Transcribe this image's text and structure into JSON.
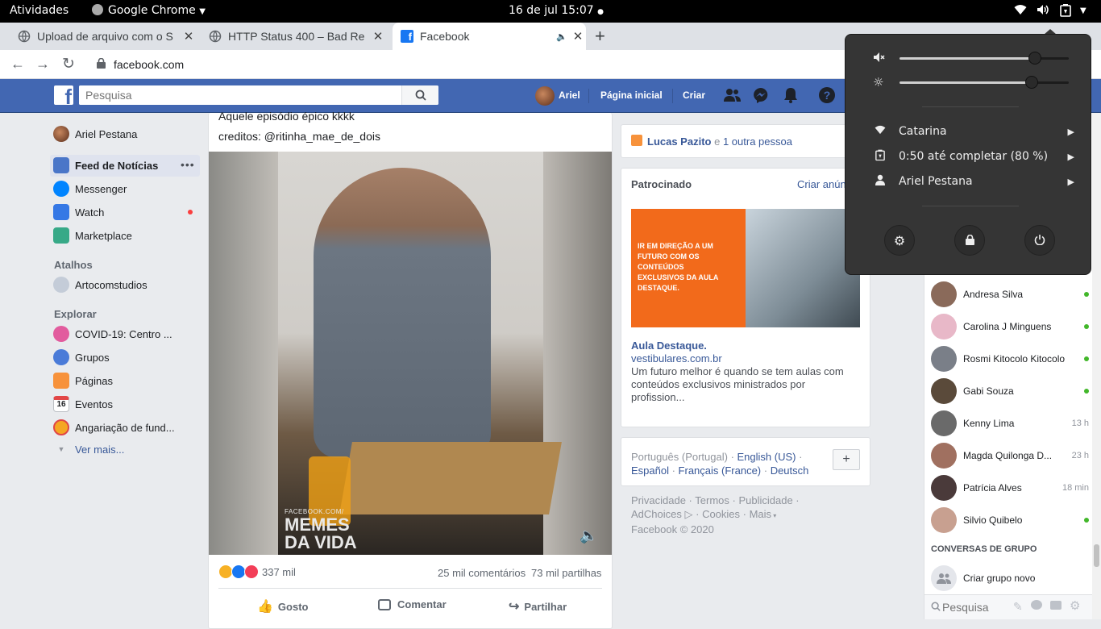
{
  "topbar": {
    "activities": "Atividades",
    "app_name": "Google Chrome",
    "clock": "16 de jul  15:07"
  },
  "tabs": [
    {
      "title": "Upload de arquivo com o S"
    },
    {
      "title": "HTTP Status 400 – Bad Re"
    },
    {
      "title": "Facebook"
    }
  ],
  "address": {
    "url": "facebook.com"
  },
  "fbbar": {
    "search_placeholder": "Pesquisa",
    "profile_name": "Ariel",
    "home": "Página inicial",
    "create": "Criar"
  },
  "left_nav": {
    "profile": "Ariel Pestana",
    "items": [
      {
        "label": "Feed de Notícias"
      },
      {
        "label": "Messenger"
      },
      {
        "label": "Watch"
      },
      {
        "label": "Marketplace"
      }
    ],
    "shortcuts_title": "Atalhos",
    "shortcuts": [
      {
        "label": "Artocomstudios"
      }
    ],
    "explore_title": "Explorar",
    "explore": [
      {
        "label": "COVID-19: Centro ..."
      },
      {
        "label": "Grupos"
      },
      {
        "label": "Páginas"
      },
      {
        "label": "Eventos"
      },
      {
        "label": "Angariação de fund..."
      }
    ],
    "see_more": "Ver mais...",
    "events_day": "16"
  },
  "post": {
    "text_line1": "Aquele episódio épico kkkk",
    "text_line2": "creditos: @ritinha_mae_de_dois",
    "watermark_small": "FACEBOOK.COM/",
    "watermark_big1": "MEMES",
    "watermark_big2": "DA VIDA",
    "reactions_count": "337 mil",
    "comments": "25 mil comentários",
    "shares": "73 mil partilhas",
    "action_like": "Gosto",
    "action_comment": "Comentar",
    "action_share": "Partilhar"
  },
  "birthday": {
    "name": "Lucas Pazito",
    "connector": "e",
    "others": "1 outra pessoa"
  },
  "sponsored": {
    "title": "Patrocinado",
    "create_ad": "Criar anún",
    "ad_image_text": "IR EM DIREÇÃO A UM FUTURO COM OS CONTEÚDOS EXCLUSIVOS DA AULA DESTAQUE.",
    "ad_name": "Aula Destaque.",
    "ad_domain": "vestibulares.com.br",
    "ad_desc": "Um futuro melhor é quando se tem aulas com conteúdos exclusivos ministrados por profission..."
  },
  "languages": {
    "current": "Português (Portugal)",
    "options": [
      "English (US)",
      "Español",
      "Français (France)",
      "Deutsch"
    ],
    "add": "+"
  },
  "footer": {
    "line1": [
      "Privacidade",
      "Termos",
      "Publicidade"
    ],
    "line2": [
      "AdChoices",
      "Cookies",
      "Mais"
    ],
    "copyright": "Facebook © 2020"
  },
  "chat": {
    "contacts": [
      {
        "name": "Andresa Silva",
        "status": "online"
      },
      {
        "name": "Carolina J Minguens",
        "status": "online"
      },
      {
        "name": "Rosmi Kitocolo Kitocolo",
        "status": "online"
      },
      {
        "name": "Gabi Souza",
        "status": "online"
      },
      {
        "name": "Kenny Lima",
        "status": "13 h"
      },
      {
        "name": "Magda Quilonga D...",
        "status": "23 h"
      },
      {
        "name": "Patrícia Alves",
        "status": "18 min"
      },
      {
        "name": "Silvio Quibelo",
        "status": "online"
      }
    ],
    "group_title": "CONVERSAS DE GRUPO",
    "new_group": "Criar grupo novo",
    "search_placeholder": "Pesquisa"
  },
  "system_menu": {
    "volume_level": 0.8,
    "brightness_level": 0.78,
    "wifi": "Catarina",
    "battery": "0:50 até completar (80 %)",
    "user": "Ariel Pestana"
  },
  "colors": {
    "fb_blue": "#4267b2",
    "link": "#385898",
    "online": "#42b72a",
    "menu_bg": "#353535"
  }
}
